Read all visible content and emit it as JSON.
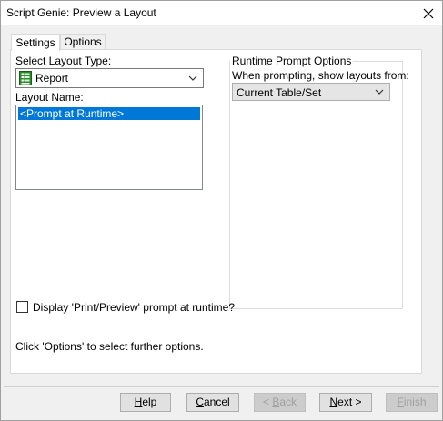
{
  "window": {
    "title": "Script Genie:  Preview a Layout"
  },
  "tabs": [
    {
      "label": "Settings",
      "active": true
    },
    {
      "label": "Options",
      "active": false
    }
  ],
  "settings": {
    "layout_type_label": "Select Layout Type:",
    "layout_type_value": "Report",
    "layout_name_label": "Layout Name:",
    "layout_names": [
      "<Prompt at Runtime>"
    ],
    "selected_layout_name": "<Prompt at Runtime>",
    "runtime_group_title": "Runtime Prompt Options",
    "prompting_label": "When prompting, show layouts from:",
    "prompting_value": "Current Table/Set",
    "checkbox_label": "Display 'Print/Preview' prompt at runtime?",
    "checkbox_checked": false,
    "hint_text": "Click 'Options' to select further options."
  },
  "buttons": {
    "help_pre": "",
    "help_key": "H",
    "help_post": "elp",
    "cancel_pre": "",
    "cancel_key": "C",
    "cancel_post": "ancel",
    "back_pre": "< ",
    "back_key": "B",
    "back_post": "ack",
    "next_pre": "",
    "next_key": "N",
    "next_post": "ext >",
    "finish_pre": "",
    "finish_key": "F",
    "finish_post": "inish"
  },
  "colors": {
    "selection": "#0078d7",
    "disabled_text": "#a0a0a0",
    "panel_background": "#ffffff",
    "dialog_background": "#f0f0f0"
  },
  "icons": {
    "close": "close-icon",
    "layout_type": "report-layout-icon",
    "dropdown": "chevron-down-icon"
  }
}
